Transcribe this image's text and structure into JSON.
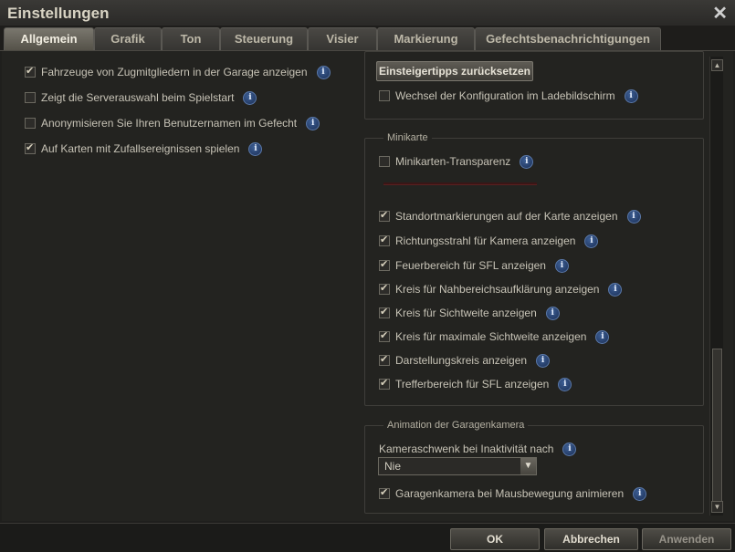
{
  "window": {
    "title": "Einstellungen"
  },
  "tabs": [
    "Allgemein",
    "Grafik",
    "Ton",
    "Steuerung",
    "Visier",
    "Markierung",
    "Gefechtsbenachrichtigungen"
  ],
  "active_tab": "Allgemein",
  "left_options": [
    {
      "label": "Fahrzeuge von Zugmitgliedern in der Garage anzeigen",
      "checked": true
    },
    {
      "label": "Zeigt die Serverauswahl beim Spielstart",
      "checked": false
    },
    {
      "label": "Anonymisieren Sie Ihren Benutzernamen im Gefecht",
      "checked": false
    },
    {
      "label": "Auf Karten mit Zufallsereignissen spielen",
      "checked": true
    }
  ],
  "tips": {
    "reset_button": "Einsteigertipps zurücksetzen",
    "config_option": {
      "label": "Wechsel der Konfiguration im Ladebildschirm",
      "checked": false
    }
  },
  "minimap": {
    "group_label": "Minikarte",
    "transparency": {
      "label": "Minikarten-Transparenz",
      "checked": false
    },
    "options": [
      {
        "label": "Standortmarkierungen auf der Karte anzeigen",
        "checked": true
      },
      {
        "label": "Richtungsstrahl für Kamera anzeigen",
        "checked": true
      },
      {
        "label": "Feuerbereich für SFL anzeigen",
        "checked": true
      },
      {
        "label": "Kreis für Nahbereichsaufklärung anzeigen",
        "checked": true
      },
      {
        "label": "Kreis für Sichtweite anzeigen",
        "checked": true
      },
      {
        "label": "Kreis für maximale Sichtweite anzeigen",
        "checked": true
      },
      {
        "label": "Darstellungskreis anzeigen",
        "checked": true
      },
      {
        "label": "Trefferbereich für SFL anzeigen",
        "checked": true
      }
    ]
  },
  "garage_camera": {
    "group_label": "Animation der Garagenkamera",
    "pan_label": "Kameraschwenk bei Inaktivität nach",
    "pan_value": "Nie",
    "animate_option": {
      "label": "Garagenkamera bei Mausbewegung animieren",
      "checked": true
    }
  },
  "info_glyph": "i",
  "footer": {
    "ok": "OK",
    "cancel": "Abbrechen",
    "apply": "Anwenden"
  }
}
